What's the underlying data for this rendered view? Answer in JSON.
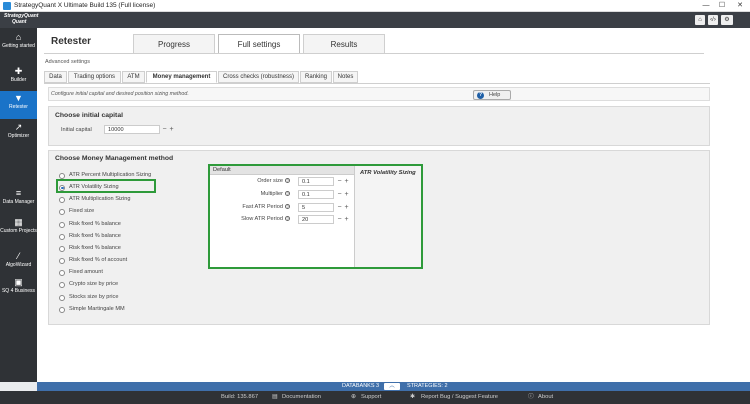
{
  "window": {
    "title": "StrategyQuant X Ultimate Build 135 (Full license)",
    "minimize": "—",
    "maximize": "☐",
    "close": "✕"
  },
  "logo": {
    "line1": "StrategyQuant",
    "line2": "Quant"
  },
  "header_buttons": {
    "home": "⌂",
    "code": "‹/›",
    "settings": "⚙"
  },
  "sidebar": {
    "items": [
      {
        "label": "Getting started",
        "icon": "home-icon"
      },
      {
        "label": "Builder",
        "icon": "plus-icon"
      },
      {
        "label": "Retester",
        "icon": "funnel-icon"
      },
      {
        "label": "Optimizer",
        "icon": "chart-icon"
      },
      {
        "label": "Data Manager",
        "icon": "database-icon"
      },
      {
        "label": "Custom Projects",
        "icon": "layers-icon"
      },
      {
        "label": "AlgoWizard",
        "icon": "wand-icon"
      },
      {
        "label": "SQ 4 Business",
        "icon": "briefcase-icon"
      }
    ]
  },
  "page": {
    "title": "Retester"
  },
  "top_tabs": [
    {
      "label": "Progress"
    },
    {
      "label": "Full settings"
    },
    {
      "label": "Results"
    }
  ],
  "advanced_label": "Advanced settings",
  "sub_tabs": [
    {
      "label": "Data"
    },
    {
      "label": "Trading options"
    },
    {
      "label": "ATM"
    },
    {
      "label": "Money management"
    },
    {
      "label": "Cross checks (robustness)"
    },
    {
      "label": "Ranking"
    },
    {
      "label": "Notes"
    }
  ],
  "info": {
    "text": "Configure initial capital and desired position sizing method.",
    "help": "Help"
  },
  "capital": {
    "title": "Choose initial capital",
    "label": "Initial capital",
    "value": "10000"
  },
  "mm": {
    "title": "Choose Money Management method",
    "selected": "ATR Volatility Sizing",
    "methods": [
      "ATR Percent Multiplication Sizing",
      "ATR Volatility Sizing",
      "ATR Multiplication Sizing",
      "Fixed size",
      "Risk fixed % balance",
      "Risk fixed % balance",
      "Risk fixed % balance",
      "Risk fixed % of account",
      "Fixed amount",
      "Crypto size by price",
      "Stocks size by price",
      "Simple Martingale MM"
    ]
  },
  "params": {
    "header": "Default",
    "title": "ATR Volatility Sizing",
    "rows": [
      {
        "label": "Order size",
        "value": "0.1"
      },
      {
        "label": "Multiplier",
        "value": "0.1"
      },
      {
        "label": "Fast ATR Period",
        "value": "5"
      },
      {
        "label": "Slow ATR Period",
        "value": "20"
      }
    ]
  },
  "status": {
    "databanks": "DATABANKS 3",
    "strategies": "STRATEGIES: 2"
  },
  "footer": {
    "build": "Build: 135.867",
    "documentation": "Documentation",
    "support": "Support",
    "report": "Report Bug / Suggest Feature",
    "about": "About"
  },
  "colors": {
    "accent": "#1a73c8",
    "highlight": "#2e9a3a",
    "sidebar": "#2f3236"
  }
}
